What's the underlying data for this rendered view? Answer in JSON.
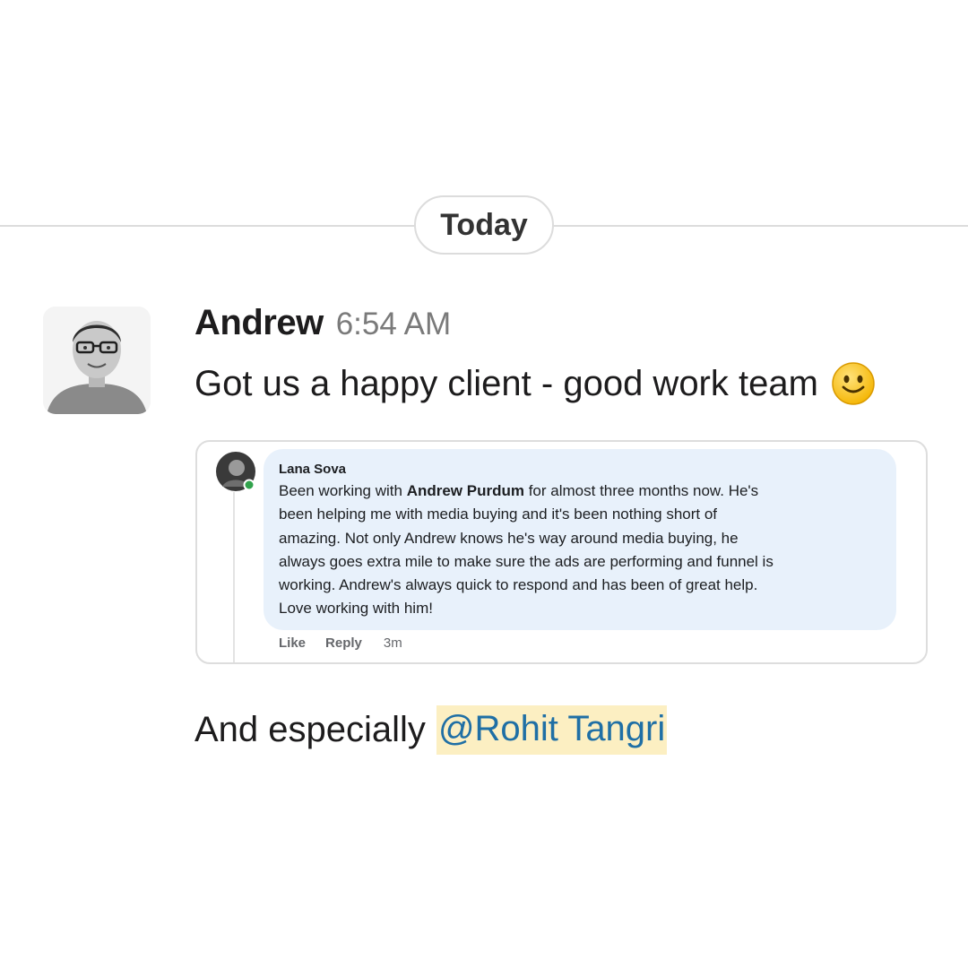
{
  "divider": {
    "date_label": "Today"
  },
  "message": {
    "sender": "Andrew",
    "time": "6:54 AM",
    "text": "Got us a happy client - good work team",
    "emoji_icon": "slightly-smiling-face-icon",
    "attachment": {
      "comment": {
        "author": "Lana Sova",
        "lines": [
          {
            "pre": "Been working with ",
            "bold": "Andrew Purdum",
            "post": " for almost three months now. He's"
          },
          {
            "text": "been helping me with media buying and it's been nothing short of"
          },
          {
            "text": "amazing. Not only Andrew knows he's way around media buying, he"
          },
          {
            "text": "always goes extra mile to make sure the ads are performing and funnel is"
          },
          {
            "text": "working. Andrew's always quick to respond and has been of great help."
          },
          {
            "text": "Love working with him!"
          }
        ],
        "like_label": "Like",
        "reply_label": "Reply",
        "time": "3m"
      }
    }
  },
  "message2": {
    "text": "And especially",
    "mention": "@Rohit Tangri"
  },
  "colors": {
    "mention_bg": "#fcefc2",
    "mention_text": "#1f6fa5",
    "comment_bubble": "#e8f1fb",
    "online_dot": "#31a24c"
  }
}
